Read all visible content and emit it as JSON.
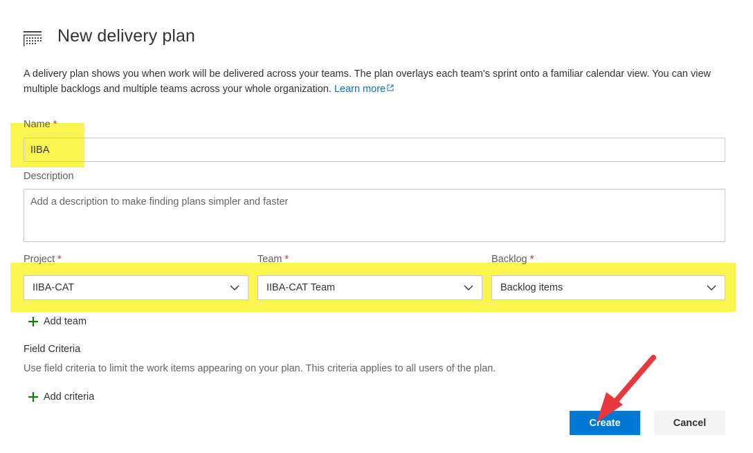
{
  "page": {
    "title": "New delivery plan",
    "description": "A delivery plan shows you when work will be delivered across your teams. The plan overlays each team's sprint onto a familiar calendar view. You can view multiple backlogs and multiple teams across your whole organization.",
    "learn_more": "Learn more"
  },
  "form": {
    "name_label": "Name",
    "name_value": "IIBA",
    "description_label": "Description",
    "description_placeholder": "Add a description to make finding plans simpler and faster",
    "required_marker": "*",
    "project_label": "Project",
    "project_value": "IIBA-CAT",
    "team_label": "Team",
    "team_value": "IIBA-CAT Team",
    "backlog_label": "Backlog",
    "backlog_value": "Backlog items",
    "add_team": "Add team"
  },
  "criteria": {
    "title": "Field Criteria",
    "description": "Use field criteria to limit the work items appearing on your plan. This criteria applies to all users of the plan.",
    "add_criteria": "Add criteria"
  },
  "actions": {
    "create": "Create",
    "cancel": "Cancel"
  },
  "colors": {
    "accent": "#0078d4",
    "plus_icon": "#107c10",
    "highlight": "#fdf54f",
    "annotation_arrow": "#e8383d"
  },
  "icons": {
    "title": "delivery-plan-icon",
    "external": "external-link-icon",
    "dropdown": "chevron-down-icon",
    "add": "plus-icon"
  }
}
